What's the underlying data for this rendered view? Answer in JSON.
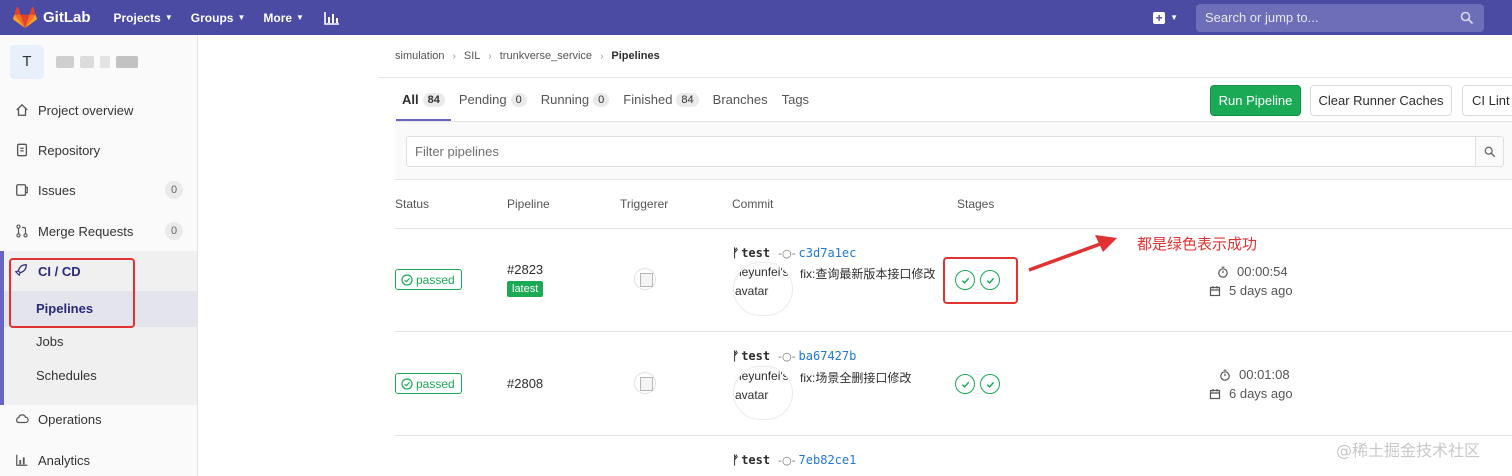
{
  "navbar": {
    "brand": "GitLab",
    "menu": [
      {
        "label": "Projects"
      },
      {
        "label": "Groups"
      },
      {
        "label": "More"
      }
    ],
    "search_placeholder": "Search or jump to...",
    "colors": {
      "bar": "#4b4ba3"
    }
  },
  "sidebar": {
    "project_initial": "T",
    "items": [
      {
        "label": "Project overview",
        "icon": "home-icon"
      },
      {
        "label": "Repository",
        "icon": "document-icon"
      },
      {
        "label": "Issues",
        "icon": "issues-icon",
        "count": "0"
      },
      {
        "label": "Merge Requests",
        "icon": "merge-request-icon",
        "count": "0"
      }
    ],
    "cicd": {
      "label": "CI / CD",
      "sub_items": [
        {
          "label": "Pipelines",
          "active": true
        },
        {
          "label": "Jobs"
        },
        {
          "label": "Schedules"
        }
      ]
    },
    "bottom_items": [
      {
        "label": "Operations",
        "icon": "cloud-icon"
      },
      {
        "label": "Analytics",
        "icon": "chart-icon"
      }
    ]
  },
  "breadcrumb": [
    "simulation",
    "SIL",
    "trunkverse_service",
    "Pipelines"
  ],
  "tabs": [
    {
      "label": "All",
      "count": "84",
      "active": true
    },
    {
      "label": "Pending",
      "count": "0"
    },
    {
      "label": "Running",
      "count": "0"
    },
    {
      "label": "Finished",
      "count": "84"
    },
    {
      "label": "Branches"
    },
    {
      "label": "Tags"
    }
  ],
  "buttons": {
    "run_pipeline": "Run Pipeline",
    "clear_caches": "Clear Runner Caches",
    "ci_lint": "CI Lint"
  },
  "filter_placeholder": "Filter pipelines",
  "table": {
    "headers": [
      "Status",
      "Pipeline",
      "Triggerer",
      "Commit",
      "Stages"
    ],
    "rows": [
      {
        "status": "passed",
        "pipeline": "#2823",
        "latest": "latest",
        "branch": "test",
        "sha": "c3d7a1ec",
        "avatar_alt": "heyunfei's avatar",
        "message": "fix:查询最新版本接口修改",
        "duration": "00:00:54",
        "finished": "5 days ago"
      },
      {
        "status": "passed",
        "pipeline": "#2808",
        "branch": "test",
        "sha": "ba67427b",
        "avatar_alt": "heyunfei's avatar",
        "message": "fix:场景全删接口修改",
        "duration": "00:01:08",
        "finished": "6 days ago"
      },
      {
        "branch": "test",
        "sha": "7eb82ce1"
      }
    ]
  },
  "annotation": {
    "text": "都是绿色表示成功",
    "color": "#e03232"
  },
  "watermark": "@稀土掘金技术社区"
}
